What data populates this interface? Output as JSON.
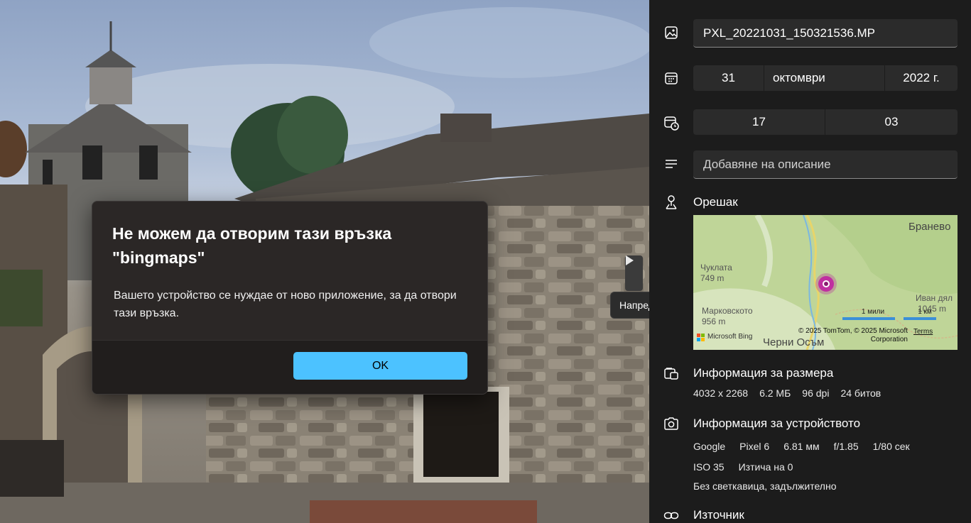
{
  "dialog": {
    "title": "Не можем да отворим тази връзка \"bingmaps\"",
    "message": "Вашето устройство се нуждае от ново приложение, за да отвори тази връзка.",
    "ok_label": "OK"
  },
  "viewer": {
    "next_tooltip": "Напред"
  },
  "info": {
    "file_name": "PXL_20221031_150321536.MP",
    "date": {
      "day": "31",
      "month": "октомври",
      "year": "2022 г."
    },
    "time": {
      "hour": "17",
      "minute": "03"
    },
    "description_placeholder": "Добавяне на описание",
    "location": "Орешак",
    "map": {
      "places": [
        "Браневo",
        "Чуклата",
        "749 m",
        "Марковското",
        "956 m",
        "Иван дял",
        "1045 m",
        "Черни Осъм"
      ],
      "scale_miles": "1 мили",
      "scale_km": "1 км",
      "copyright": "© 2025 TomTom, © 2025 Microsoft Corporation",
      "terms": "Terms",
      "provider": "Microsoft Bing"
    },
    "size_section": {
      "title": "Информация за размера",
      "dimensions": "4032 x 2268",
      "file_size": "6.2 МБ",
      "dpi": "96 dpi",
      "bits": "24 битов"
    },
    "device_section": {
      "title": "Информация за устройството",
      "make": "Google",
      "model": "Pixel 6",
      "focal_length": "6.81 мм",
      "aperture": "f/1.85",
      "shutter": "1/80 сек",
      "iso": "ISO 35",
      "exposure_bias": "Изтича на 0",
      "flash": "Без светкавица, задължително"
    },
    "source_section": {
      "title": "Източник"
    }
  }
}
